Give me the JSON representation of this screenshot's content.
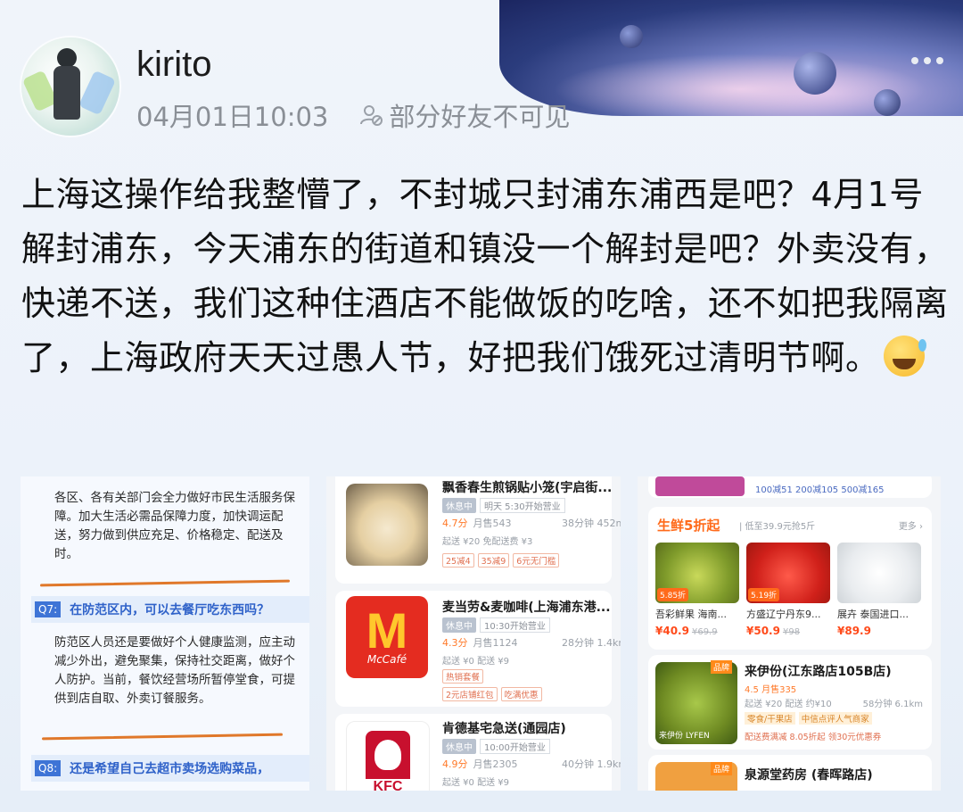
{
  "post": {
    "username": "kirito",
    "date": "04月01日10:03",
    "visibility": "部分好友不可见",
    "text": "上海这操作给我整懵了，不封城只封浦东浦西是吧？4月1号解封浦东，今天浦东的街道和镇没一个解封是吧？外卖没有，快递不送，我们这种住酒店不能做饭的吃啥，还不如把我隔离了，上海政府天天过愚人节，好把我们饿死过清明节啊。"
  },
  "image1": {
    "para1": "各区、各有关部门会全力做好市民生活服务保障。加大生活必需品保障力度，加快调运配送，努力做到供应充足、价格稳定、配送及时。",
    "q7_tag": "Q7:",
    "q7_text": "在防范区内，可以去餐厅吃东西吗？",
    "para2": "防范区人员还是要做好个人健康监测，应主动减少外出，避免聚集，保持社交距离，做好个人防护。当前，餐饮经营场所暂停堂食，可提供到店自取、外卖订餐服务。",
    "q8_tag": "Q8:",
    "q8_text": "还是希望自己去超市卖场选购菜品，"
  },
  "image2": {
    "shops": [
      {
        "name": "飘香春生煎锅贴小笼(宇启街...",
        "status": "休息中",
        "open_time": "明天 5:30开始营业",
        "rating": "4.7分",
        "sales": "月售543",
        "right": "38分钟 452m",
        "fee": "起送 ¥20  免配送费 ¥3",
        "tags": [
          "25减4",
          "35减9",
          "6元无门槛"
        ]
      },
      {
        "name": "麦当劳&麦咖啡(上海浦东港...",
        "status": "休息中",
        "open_time": "10:30开始营业",
        "rating": "4.3分",
        "sales": "月售1124",
        "right": "28分钟 1.4km",
        "fee": "起送 ¥0  配送 ¥9",
        "tags": [
          "热销套餐",
          "2元店铺红包",
          "吃满优惠"
        ]
      },
      {
        "name": "肯德基宅急送(通园店)",
        "status": "休息中",
        "open_time": "10:00开始营业",
        "rating": "4.9分",
        "sales": "月售2305",
        "right": "40分钟 1.9km",
        "fee": "起送 ¥0  配送 ¥9",
        "tags": []
      }
    ],
    "mcd_letter": "M",
    "mcd_cafe": "McCafé",
    "kfc_label": "KFC"
  },
  "image3": {
    "top_tags": "100减51  200减105  500减165",
    "fresh_title": "生鲜5折起",
    "fresh_sub": "| 低至39.9元抢5斤",
    "fresh_more": "更多 ›",
    "products": [
      {
        "name": "吾彩鲜果 海南...",
        "price": "¥40.9",
        "orig": "¥69.9",
        "disc": "5.85折",
        "color": "#9bc24a"
      },
      {
        "name": "方盛辽宁丹东9...",
        "price": "¥50.9",
        "orig": "¥98",
        "disc": "5.19折",
        "color": "#e8322a"
      },
      {
        "name": "展卉 泰国进口...",
        "price": "¥89.9",
        "orig": "",
        "disc": "",
        "color": "#f2f2f2"
      }
    ],
    "store1_name": "来伊份(江东路店105B店)",
    "store1_rating": "4.5  月售335",
    "store1_fee": "起送 ¥20  配送 约¥10",
    "store1_right": "58分钟 6.1km",
    "store1_tags": [
      "零食/干果店",
      "中信点评人气商家"
    ],
    "store1_promo": "配送费满减  8.05折起  领30元优惠券",
    "store1_logo": "来伊份 LYFEN",
    "store2_name": "泉源堂药房 (春晖路店)",
    "brand_tag": "品牌"
  },
  "colors": {
    "accent_orange": "#ff6a1a",
    "link_blue": "#2f62c9",
    "meta_gray": "#8a8f96"
  }
}
